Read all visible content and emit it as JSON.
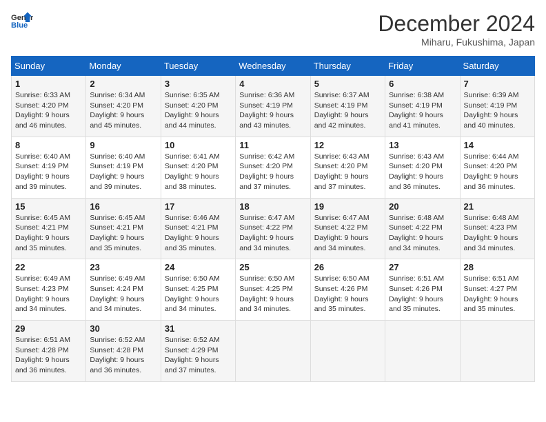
{
  "logo": {
    "line1": "General",
    "line2": "Blue"
  },
  "title": "December 2024",
  "location": "Miharu, Fukushima, Japan",
  "days_of_week": [
    "Sunday",
    "Monday",
    "Tuesday",
    "Wednesday",
    "Thursday",
    "Friday",
    "Saturday"
  ],
  "weeks": [
    [
      {
        "day": "1",
        "sunrise": "Sunrise: 6:33 AM",
        "sunset": "Sunset: 4:20 PM",
        "daylight": "Daylight: 9 hours and 46 minutes."
      },
      {
        "day": "2",
        "sunrise": "Sunrise: 6:34 AM",
        "sunset": "Sunset: 4:20 PM",
        "daylight": "Daylight: 9 hours and 45 minutes."
      },
      {
        "day": "3",
        "sunrise": "Sunrise: 6:35 AM",
        "sunset": "Sunset: 4:20 PM",
        "daylight": "Daylight: 9 hours and 44 minutes."
      },
      {
        "day": "4",
        "sunrise": "Sunrise: 6:36 AM",
        "sunset": "Sunset: 4:19 PM",
        "daylight": "Daylight: 9 hours and 43 minutes."
      },
      {
        "day": "5",
        "sunrise": "Sunrise: 6:37 AM",
        "sunset": "Sunset: 4:19 PM",
        "daylight": "Daylight: 9 hours and 42 minutes."
      },
      {
        "day": "6",
        "sunrise": "Sunrise: 6:38 AM",
        "sunset": "Sunset: 4:19 PM",
        "daylight": "Daylight: 9 hours and 41 minutes."
      },
      {
        "day": "7",
        "sunrise": "Sunrise: 6:39 AM",
        "sunset": "Sunset: 4:19 PM",
        "daylight": "Daylight: 9 hours and 40 minutes."
      }
    ],
    [
      {
        "day": "8",
        "sunrise": "Sunrise: 6:40 AM",
        "sunset": "Sunset: 4:19 PM",
        "daylight": "Daylight: 9 hours and 39 minutes."
      },
      {
        "day": "9",
        "sunrise": "Sunrise: 6:40 AM",
        "sunset": "Sunset: 4:19 PM",
        "daylight": "Daylight: 9 hours and 39 minutes."
      },
      {
        "day": "10",
        "sunrise": "Sunrise: 6:41 AM",
        "sunset": "Sunset: 4:20 PM",
        "daylight": "Daylight: 9 hours and 38 minutes."
      },
      {
        "day": "11",
        "sunrise": "Sunrise: 6:42 AM",
        "sunset": "Sunset: 4:20 PM",
        "daylight": "Daylight: 9 hours and 37 minutes."
      },
      {
        "day": "12",
        "sunrise": "Sunrise: 6:43 AM",
        "sunset": "Sunset: 4:20 PM",
        "daylight": "Daylight: 9 hours and 37 minutes."
      },
      {
        "day": "13",
        "sunrise": "Sunrise: 6:43 AM",
        "sunset": "Sunset: 4:20 PM",
        "daylight": "Daylight: 9 hours and 36 minutes."
      },
      {
        "day": "14",
        "sunrise": "Sunrise: 6:44 AM",
        "sunset": "Sunset: 4:20 PM",
        "daylight": "Daylight: 9 hours and 36 minutes."
      }
    ],
    [
      {
        "day": "15",
        "sunrise": "Sunrise: 6:45 AM",
        "sunset": "Sunset: 4:21 PM",
        "daylight": "Daylight: 9 hours and 35 minutes."
      },
      {
        "day": "16",
        "sunrise": "Sunrise: 6:45 AM",
        "sunset": "Sunset: 4:21 PM",
        "daylight": "Daylight: 9 hours and 35 minutes."
      },
      {
        "day": "17",
        "sunrise": "Sunrise: 6:46 AM",
        "sunset": "Sunset: 4:21 PM",
        "daylight": "Daylight: 9 hours and 35 minutes."
      },
      {
        "day": "18",
        "sunrise": "Sunrise: 6:47 AM",
        "sunset": "Sunset: 4:22 PM",
        "daylight": "Daylight: 9 hours and 34 minutes."
      },
      {
        "day": "19",
        "sunrise": "Sunrise: 6:47 AM",
        "sunset": "Sunset: 4:22 PM",
        "daylight": "Daylight: 9 hours and 34 minutes."
      },
      {
        "day": "20",
        "sunrise": "Sunrise: 6:48 AM",
        "sunset": "Sunset: 4:22 PM",
        "daylight": "Daylight: 9 hours and 34 minutes."
      },
      {
        "day": "21",
        "sunrise": "Sunrise: 6:48 AM",
        "sunset": "Sunset: 4:23 PM",
        "daylight": "Daylight: 9 hours and 34 minutes."
      }
    ],
    [
      {
        "day": "22",
        "sunrise": "Sunrise: 6:49 AM",
        "sunset": "Sunset: 4:23 PM",
        "daylight": "Daylight: 9 hours and 34 minutes."
      },
      {
        "day": "23",
        "sunrise": "Sunrise: 6:49 AM",
        "sunset": "Sunset: 4:24 PM",
        "daylight": "Daylight: 9 hours and 34 minutes."
      },
      {
        "day": "24",
        "sunrise": "Sunrise: 6:50 AM",
        "sunset": "Sunset: 4:25 PM",
        "daylight": "Daylight: 9 hours and 34 minutes."
      },
      {
        "day": "25",
        "sunrise": "Sunrise: 6:50 AM",
        "sunset": "Sunset: 4:25 PM",
        "daylight": "Daylight: 9 hours and 34 minutes."
      },
      {
        "day": "26",
        "sunrise": "Sunrise: 6:50 AM",
        "sunset": "Sunset: 4:26 PM",
        "daylight": "Daylight: 9 hours and 35 minutes."
      },
      {
        "day": "27",
        "sunrise": "Sunrise: 6:51 AM",
        "sunset": "Sunset: 4:26 PM",
        "daylight": "Daylight: 9 hours and 35 minutes."
      },
      {
        "day": "28",
        "sunrise": "Sunrise: 6:51 AM",
        "sunset": "Sunset: 4:27 PM",
        "daylight": "Daylight: 9 hours and 35 minutes."
      }
    ],
    [
      {
        "day": "29",
        "sunrise": "Sunrise: 6:51 AM",
        "sunset": "Sunset: 4:28 PM",
        "daylight": "Daylight: 9 hours and 36 minutes."
      },
      {
        "day": "30",
        "sunrise": "Sunrise: 6:52 AM",
        "sunset": "Sunset: 4:28 PM",
        "daylight": "Daylight: 9 hours and 36 minutes."
      },
      {
        "day": "31",
        "sunrise": "Sunrise: 6:52 AM",
        "sunset": "Sunset: 4:29 PM",
        "daylight": "Daylight: 9 hours and 37 minutes."
      },
      null,
      null,
      null,
      null
    ]
  ]
}
